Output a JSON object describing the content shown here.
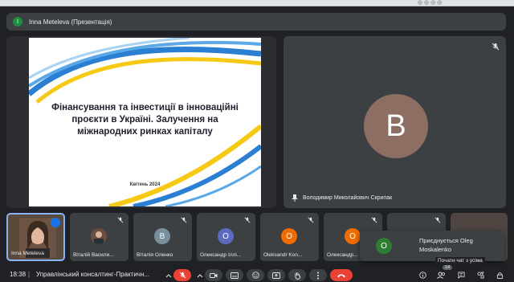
{
  "browser": {
    "tab_fragment": "◎ ◎ ◎ ◎"
  },
  "presenter": {
    "initial": "I",
    "label": "Inna Meteleva (Презентація)"
  },
  "slide": {
    "title_line1": "Фінансування та інвестиції в інноваційні",
    "title_line2": "проєкти в Україні. Залучення на",
    "title_line3": "міжнародних ринках капіталу",
    "date": "Квітень 2024"
  },
  "main_participant": {
    "initial": "B",
    "name": "Володимир Миколайович Скрипак",
    "avatar_color": "#8d6e63"
  },
  "participants": [
    {
      "name": "Inna Meteleva",
      "initial": "",
      "color": "#5a4a3c"
    },
    {
      "name": "Віталій Васили...",
      "initial": "",
      "color": "#6d4c41"
    },
    {
      "name": "Віталія Оленко",
      "initial": "В",
      "color": "#78909c"
    },
    {
      "name": "Олександр Іллі...",
      "initial": "О",
      "color": "#5c6bc0"
    },
    {
      "name": "Oleksandr Kon...",
      "initial": "O",
      "color": "#ef6c00"
    },
    {
      "name": "Олександр...",
      "initial": "О",
      "color": "#ef6c00"
    }
  ],
  "toast": {
    "initial": "O",
    "line1": "Приєднується Oleg",
    "line2": "Moskalenko",
    "avatar_color": "#2e7d32"
  },
  "tooltip": {
    "text": "Почати чат з усіма"
  },
  "badge": {
    "count": "14"
  },
  "bottom_bar": {
    "time": "18:38",
    "separator": "|",
    "meeting_title": "Управлінський консалтинг-Практичн..."
  },
  "colors": {
    "accent": "#8ab4f8",
    "end_call": "#ea4335",
    "surface": "#3c4043",
    "background": "#202124"
  }
}
